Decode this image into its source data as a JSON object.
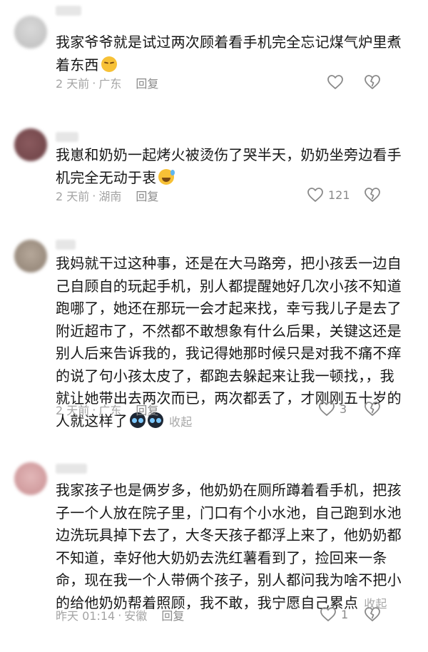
{
  "comments": [
    {
      "text": "我家爷爷就是试过两次顾着看手机完全忘记煤气炉里煮着东西",
      "emoji": "pensive-face",
      "time": "2 天前",
      "location": "广东",
      "reply": "回复",
      "likes": "",
      "collapse": ""
    },
    {
      "text": "我崽和奶奶一起烤火被烫伤了哭半天，奶奶坐旁边看手机完全无动于衷",
      "emoji": "grinning-sweat-face",
      "time": "2 天前",
      "location": "湖南",
      "reply": "回复",
      "likes": "121",
      "collapse": ""
    },
    {
      "text": "我妈就干过这种事，还是在大马路旁，把小孩丢一边自己自顾自的玩起手机，别人都提醒她好几次小孩不知道跑哪了，她还在那玩一会才起来找，幸亏我儿子是去了附近超市了，不然都不敢想象有什么后果，关键这还是别人后来告诉我的，我记得她那时候只是对我不痛不痒的说了句小孩太皮了，都跑去躲起来让我一顿找，，我就让她带出去两次而已，两次都丢了，才刚刚五十岁的人就这样了",
      "emoji": "sob-emoji-x2",
      "time": "2 天前",
      "location": "广东",
      "reply": "回复",
      "likes": "3",
      "collapse": "收起"
    },
    {
      "text": "我家孩子也是俩岁多，他奶奶在厕所蹲着看手机，把孩子一个人放在院子里，门口有个小水池，自己跑到水池边洗玩具掉下去了，大冬天孩子都浮上来了，他奶奶都不知道，幸好他大奶奶去洗红薯看到了，捡回来一条命，现在我一个人带俩个孩子，别人都问我为啥不把小的给他奶奶帮着照顾，我不敢，我宁愿自己累点",
      "emoji": "",
      "time": "昨天 01:14",
      "location": "安徽",
      "reply": "回复",
      "likes": "1",
      "collapse": "收起"
    }
  ],
  "separator": "·",
  "colors": {
    "text": "#161616",
    "meta": "#a4a4a4",
    "icon": "#8a8a8a",
    "background": "#ffffff"
  },
  "icons": {
    "like": "heart-outline-icon",
    "dislike": "broken-heart-outline-icon"
  }
}
